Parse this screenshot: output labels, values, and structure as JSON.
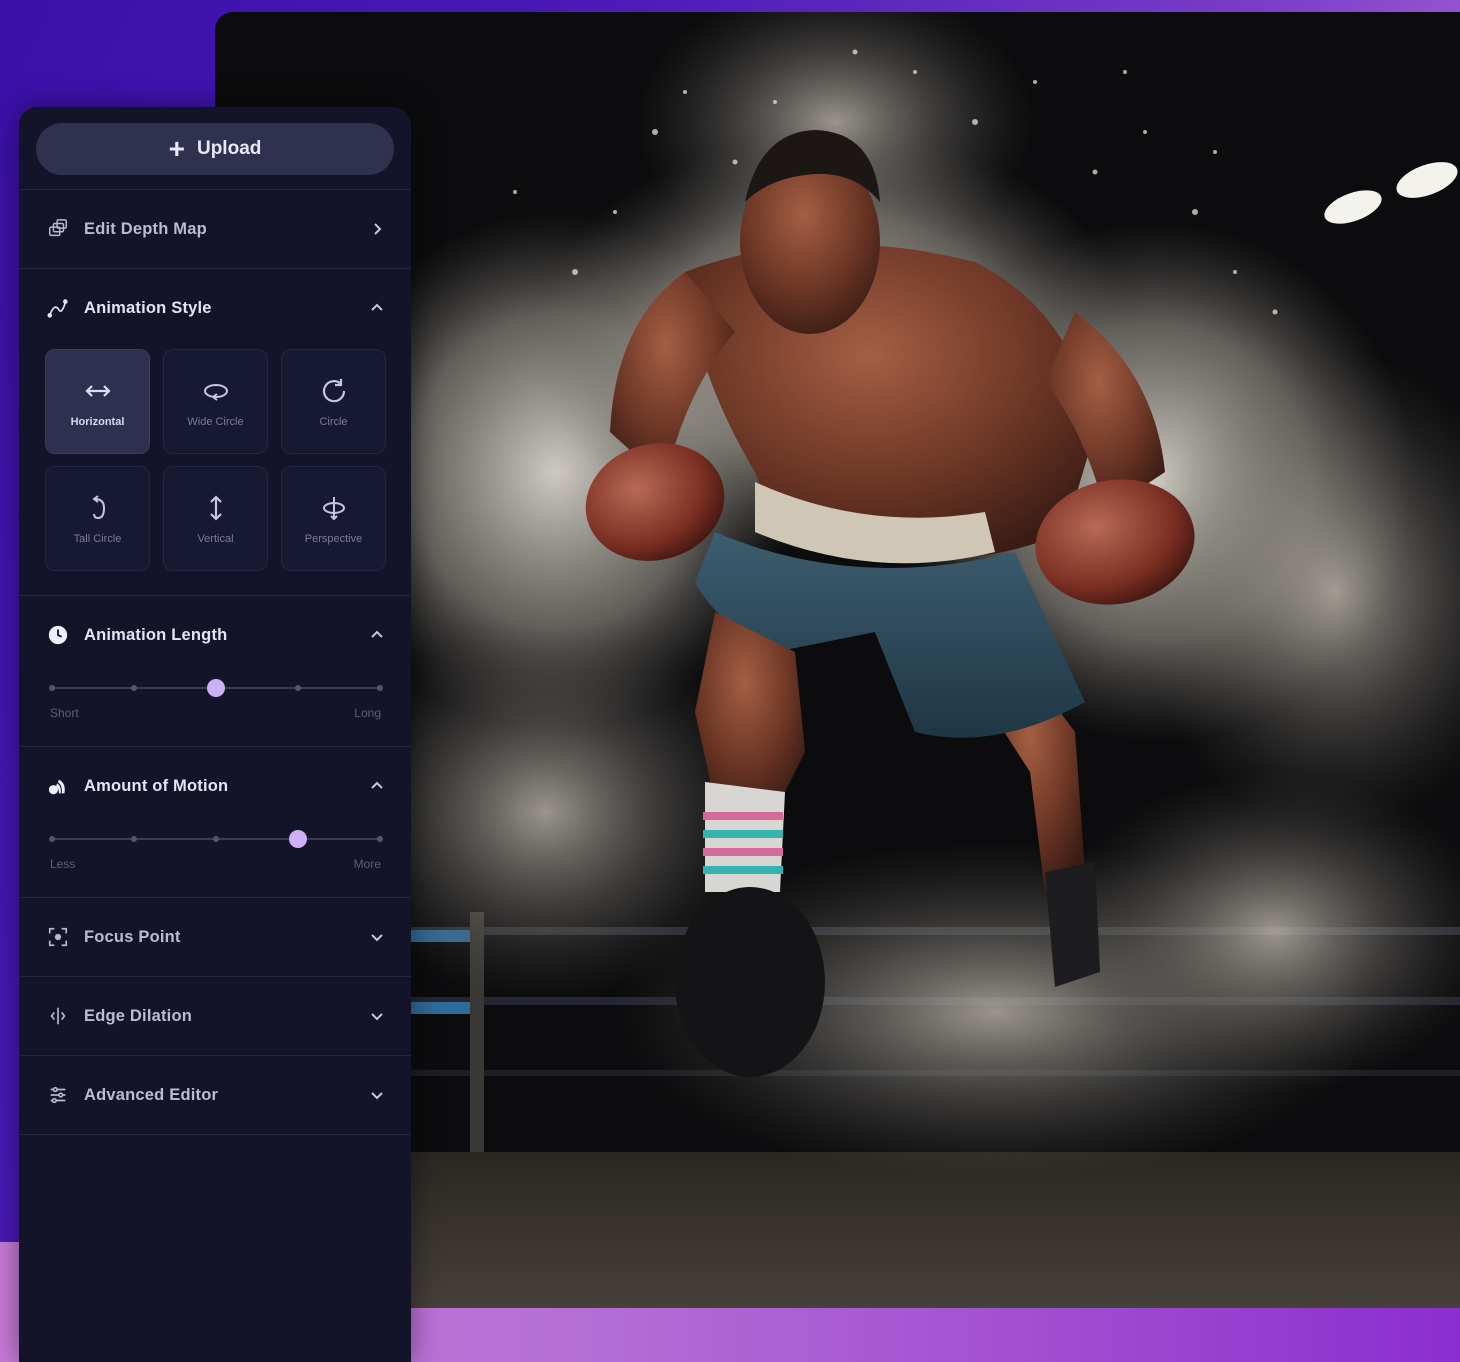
{
  "upload": {
    "label": "Upload"
  },
  "sections": {
    "edit_depth_map": {
      "title": "Edit Depth Map",
      "state": "collapsed"
    },
    "animation_style": {
      "title": "Animation Style",
      "state": "expanded",
      "options": [
        {
          "label": "Horizontal",
          "icon": "horizontal-arrows-icon",
          "selected": true
        },
        {
          "label": "Wide Circle",
          "icon": "wide-circle-icon",
          "selected": false
        },
        {
          "label": "Circle",
          "icon": "circle-arrow-icon",
          "selected": false
        },
        {
          "label": "Tall Circle",
          "icon": "tall-circle-icon",
          "selected": false
        },
        {
          "label": "Vertical",
          "icon": "vertical-arrows-icon",
          "selected": false
        },
        {
          "label": "Perspective",
          "icon": "perspective-icon",
          "selected": false
        }
      ]
    },
    "animation_length": {
      "title": "Animation Length",
      "state": "expanded",
      "min_label": "Short",
      "max_label": "Long",
      "steps": 5,
      "value_index": 2
    },
    "amount_of_motion": {
      "title": "Amount of Motion",
      "state": "expanded",
      "min_label": "Less",
      "max_label": "More",
      "steps": 5,
      "value_index": 3
    },
    "focus_point": {
      "title": "Focus Point",
      "state": "collapsed"
    },
    "edge_dilation": {
      "title": "Edge Dilation",
      "state": "collapsed"
    },
    "advanced_editor": {
      "title": "Advanced Editor",
      "state": "collapsed"
    }
  },
  "colors": {
    "panel_bg": "#13142a",
    "accent": "#cdb0f5",
    "selected_tile": "#2e3050"
  }
}
